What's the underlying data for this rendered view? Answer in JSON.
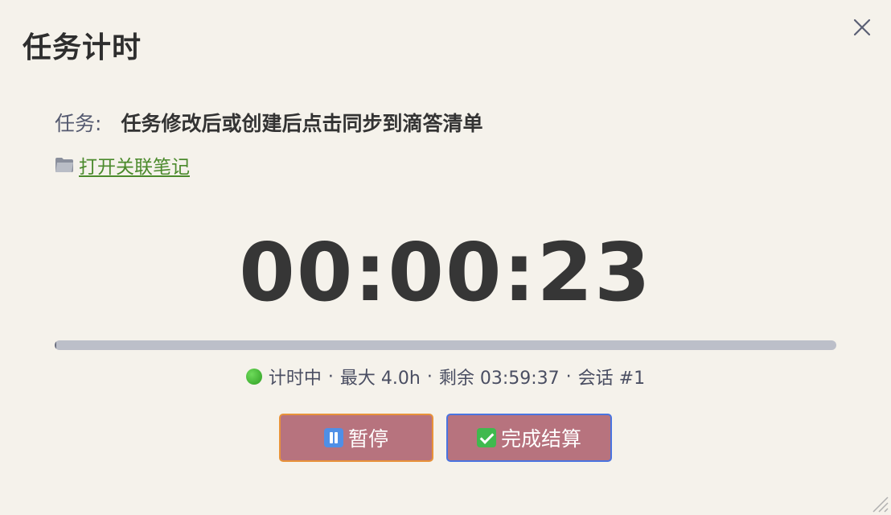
{
  "dialog": {
    "title": "任务计时"
  },
  "task": {
    "label": "任务:",
    "name": "任务修改后或创建后点击同步到滴答清单"
  },
  "note_link": {
    "label": "打开关联笔记",
    "icon": "folder-icon"
  },
  "timer": {
    "display": "00:00:23"
  },
  "progress": {
    "percent": 0.16
  },
  "status": {
    "state": "计时中",
    "max": "最大 4.0h",
    "remaining": "剩余 03:59:37",
    "session": "会话 #1",
    "separator": "·",
    "dot_color": "#3fae2c"
  },
  "buttons": {
    "pause_label": "暂停",
    "finish_label": "完成结算"
  },
  "colors": {
    "background": "#f5f2eb",
    "button_bg": "#b7737e",
    "pause_border": "#e8923a",
    "finish_border": "#4a74e0",
    "link": "#4b8a2c"
  }
}
